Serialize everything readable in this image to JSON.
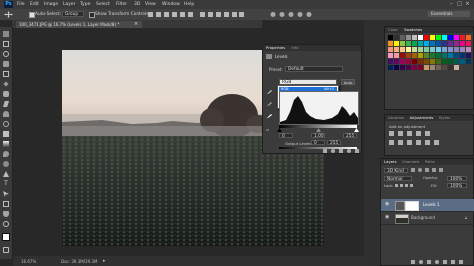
{
  "app": {
    "logo": "Ps"
  },
  "menu": [
    "File",
    "Edit",
    "Image",
    "Layer",
    "Type",
    "Select",
    "Filter",
    "3D",
    "View",
    "Window",
    "Help"
  ],
  "options": {
    "auto_select_label": "Auto-Select:",
    "auto_select_value": "Group",
    "show_transform_label": "Show Transform Controls",
    "auto_select_checked": true,
    "workspace": "Essentials"
  },
  "document": {
    "tab_title": "100_3471.JPG @ 16.7% (Levels 1, Layer Mask/8) *",
    "zoom": "16.67%",
    "doc_info": "Doc: 39.3M/39.3M"
  },
  "properties": {
    "tab": "Properties",
    "tab2": "Info",
    "title": "Levels",
    "preset_label": "Preset:",
    "preset_value": "Default",
    "channel_value": "RGB",
    "auto_label": "Auto",
    "channel_options": [
      {
        "label": "RGB",
        "shortcut": "Alt+2",
        "selected": true
      },
      {
        "label": "Red",
        "shortcut": "Alt+3",
        "selected": false
      },
      {
        "label": "Green",
        "shortcut": "Alt+4",
        "selected": false
      },
      {
        "label": "Blue",
        "shortcut": "Alt+5",
        "selected": false
      }
    ],
    "input_black": "0",
    "input_gray": "1.00",
    "input_white": "255",
    "output_label": "Output Levels:",
    "output_black": "0",
    "output_white": "255"
  },
  "swatches": {
    "tab": "Color",
    "tab2": "Swatches",
    "colors": [
      "#000000",
      "#303030",
      "#606060",
      "#909090",
      "#c0c0c0",
      "#ffffff",
      "#ff0000",
      "#ffff00",
      "#00ff00",
      "#00ffff",
      "#0000ff",
      "#ff00ff",
      "#ed1c24",
      "#f26522",
      "#f7941d",
      "#fff200",
      "#8dc63f",
      "#39b54a",
      "#00a651",
      "#00a99d",
      "#00aeef",
      "#0072bc",
      "#0054a6",
      "#2e3192",
      "#662d91",
      "#92278f",
      "#ec008c",
      "#ed145b",
      "#f7977a",
      "#f9ad81",
      "#fdc68a",
      "#fff79a",
      "#c4df9b",
      "#a3d39c",
      "#82ca9d",
      "#7accc8",
      "#6dcff6",
      "#7da7d9",
      "#8393ca",
      "#8781bd",
      "#a186be",
      "#bd8cbf",
      "#f49ac1",
      "#f5989d",
      "#9e0b0f",
      "#a0410d",
      "#a36209",
      "#aba000",
      "#598527",
      "#1a7b30",
      "#007236",
      "#00746b",
      "#0076a3",
      "#004b80",
      "#003471",
      "#1b1464",
      "#440e62",
      "#630460",
      "#9e005d",
      "#9e0039",
      "#790000",
      "#7b2e00",
      "#7d4900",
      "#827b00",
      "#406618",
      "#005e20",
      "#005826",
      "#005952",
      "#005b7f",
      "#003663",
      "#002157",
      "#0d004c",
      "#32004b",
      "#4b0049",
      "#7b0046",
      "#7a0026",
      "#c69c6d",
      "#998675",
      "#736357",
      "#534741",
      "#362f2d",
      "#c2b59b"
    ]
  },
  "adjustments": {
    "tab": "Libraries",
    "tab2": "Adjustments",
    "tab3": "Styles",
    "heading": "Add an adjustment"
  },
  "layers": {
    "tabs": [
      "Layers",
      "Channels",
      "Paths"
    ],
    "kind": "3D Kind",
    "blend": "Normal",
    "opacity_label": "Opacity:",
    "opacity_value": "100%",
    "lock_label": "Lock:",
    "fill_label": "Fill:",
    "fill_value": "100%",
    "items": [
      {
        "name": "Levels 1",
        "active": true
      },
      {
        "name": "Background",
        "active": false
      }
    ]
  }
}
